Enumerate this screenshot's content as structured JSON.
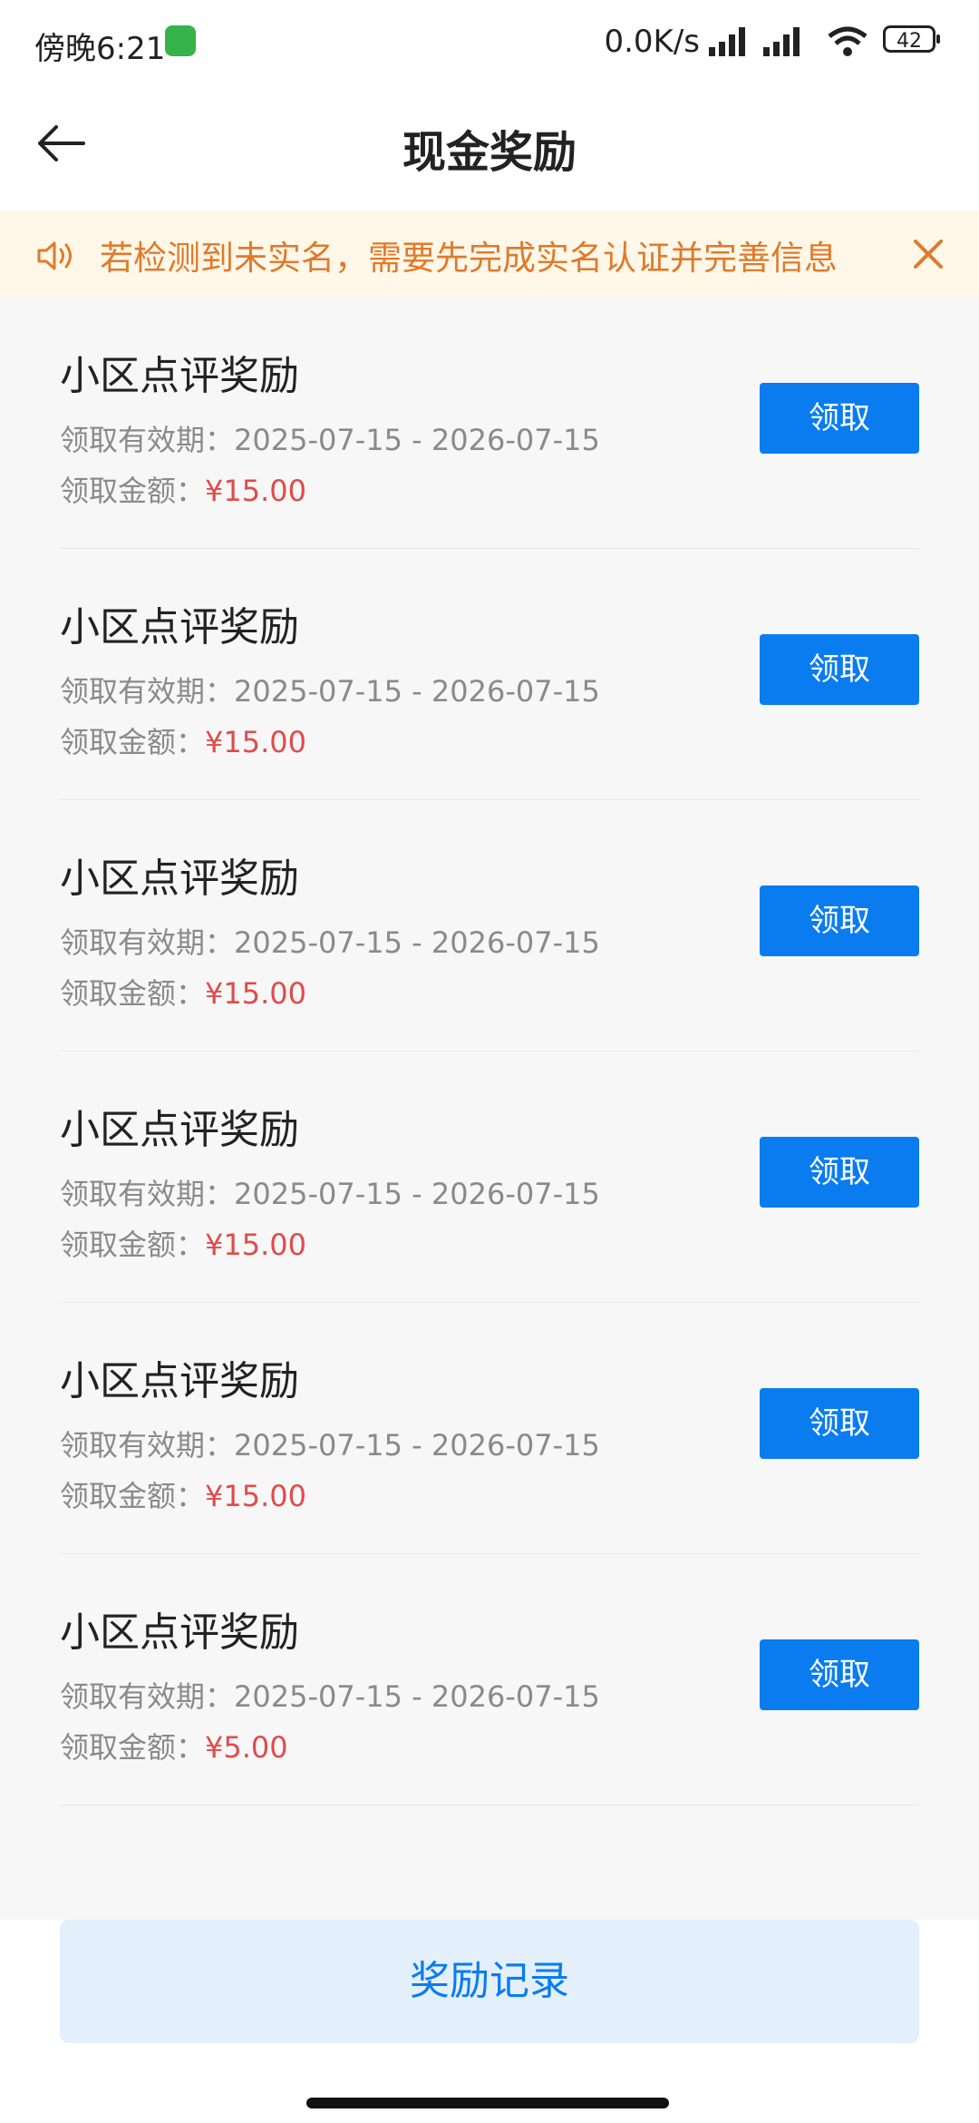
{
  "status_bar": {
    "time": "傍晚6:21",
    "network_speed": "0.0K/s",
    "battery_level": "42"
  },
  "header": {
    "title": "现金奖励",
    "back_icon": "arrow-left-icon"
  },
  "notice": {
    "icon": "speaker-icon",
    "text": "若检测到未实名，需要先完成实名认证并完善信息",
    "close_icon": "close-icon"
  },
  "rewards": [
    {
      "title": "小区点评奖励",
      "period_label": "领取有效期：",
      "period": "2025-07-15 - 2026-07-15",
      "amount_label": "领取金额：",
      "amount": "¥15.00",
      "button": "领取"
    },
    {
      "title": "小区点评奖励",
      "period_label": "领取有效期：",
      "period": "2025-07-15 - 2026-07-15",
      "amount_label": "领取金额：",
      "amount": "¥15.00",
      "button": "领取"
    },
    {
      "title": "小区点评奖励",
      "period_label": "领取有效期：",
      "period": "2025-07-15 - 2026-07-15",
      "amount_label": "领取金额：",
      "amount": "¥15.00",
      "button": "领取"
    },
    {
      "title": "小区点评奖励",
      "period_label": "领取有效期：",
      "period": "2025-07-15 - 2026-07-15",
      "amount_label": "领取金额：",
      "amount": "¥15.00",
      "button": "领取"
    },
    {
      "title": "小区点评奖励",
      "period_label": "领取有效期：",
      "period": "2025-07-15 - 2026-07-15",
      "amount_label": "领取金额：",
      "amount": "¥15.00",
      "button": "领取"
    },
    {
      "title": "小区点评奖励",
      "period_label": "领取有效期：",
      "period": "2025-07-15 - 2026-07-15",
      "amount_label": "领取金额：",
      "amount": "¥5.00",
      "button": "领取"
    }
  ],
  "records_button": "奖励记录",
  "colors": {
    "primary": "#0a7cf0",
    "amount": "#e04b4b",
    "notice_text": "#e07a2b",
    "notice_bg": "#fff7e8"
  }
}
